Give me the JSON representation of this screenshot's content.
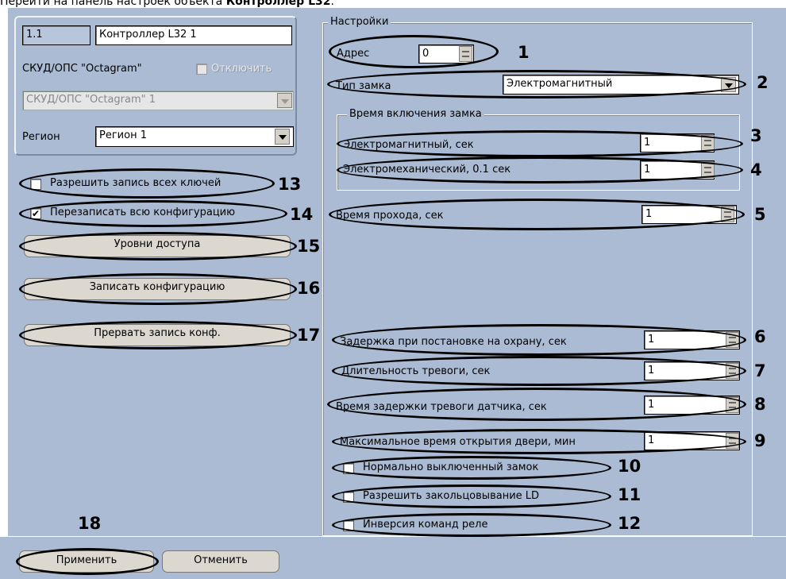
{
  "caption": {
    "prefix": "Перейти на панель настроек объекта ",
    "bold": "Контроллер L32",
    "suffix": "."
  },
  "left": {
    "id_value": "1.1",
    "name_value": "Контроллер L32 1",
    "parent_label": "СКУД/ОПС \"Octagram\"",
    "disable_label": "Отключить",
    "parent_select_value": "СКУД/ОПС \"Octagram\" 1",
    "region_label": "Регион",
    "region_value": "Регион 1",
    "allow_all_keys_label": "Разрешить запись всех ключей",
    "allow_all_keys_checked": false,
    "overwrite_config_label": "Перезаписать всю конфигурацию",
    "overwrite_config_checked": true,
    "access_levels_button": "Уровни доступа",
    "write_config_button": "Записать конфигурацию",
    "abort_write_button": "Прервать запись конф."
  },
  "settings": {
    "group_title": "Настройки",
    "address_label": "Адрес",
    "address_value": "0",
    "lock_type_label": "Тип замка",
    "lock_type_value": "Электромагнитный",
    "lock_time_group": "Время включения замка",
    "em_label": "Электромагнитный, сек",
    "em_value": "1",
    "emech_label": "Электромеханический, 0.1 сек",
    "emech_value": "1",
    "pass_time_label": "Время прохода, сек",
    "pass_time_value": "1",
    "arm_delay_label": "Задержка при постановке на охрану, сек",
    "arm_delay_value": "1",
    "alarm_duration_label": "Длительность тревоги, сек",
    "alarm_duration_value": "1",
    "sensor_delay_label": "Время задержки тревоги датчика, сек",
    "sensor_delay_value": "1",
    "max_open_label": "Максимальное время открытия двери, мин",
    "max_open_value": "1",
    "normally_off_label": "Нормально выключенный замок",
    "loop_ld_label": "Разрешить закольцовывание LD",
    "relay_inv_label": "Инверсия команд реле"
  },
  "footer": {
    "apply_button": "Применить",
    "cancel_button": "Отменить"
  },
  "callouts": {
    "n1": "1",
    "n2": "2",
    "n3": "3",
    "n4": "4",
    "n5": "5",
    "n6": "6",
    "n7": "7",
    "n8": "8",
    "n9": "9",
    "n10": "10",
    "n11": "11",
    "n12": "12",
    "n13": "13",
    "n14": "14",
    "n15": "15",
    "n16": "16",
    "n17": "17",
    "n18": "18"
  },
  "colors": {
    "panel_bg": "#aabbd3",
    "button_bg": "#dcd8cf"
  }
}
